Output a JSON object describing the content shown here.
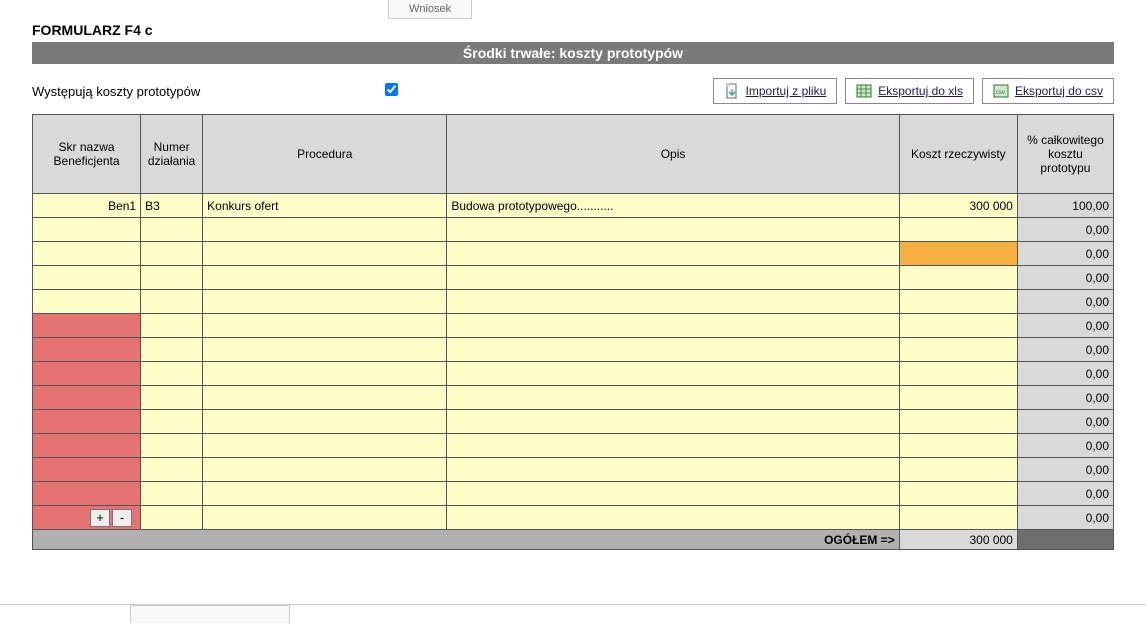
{
  "top_tab": "Wniosek",
  "form_title": "FORMULARZ F4 c",
  "banner": "Środki trwałe: koszty prototypów",
  "checkbox_label": "Występują koszty prototypów",
  "checkbox_checked": true,
  "buttons": {
    "import": "Importuj z pliku",
    "export_xls": "Eksportuj do xls",
    "export_csv": "Eksportuj do csv"
  },
  "columns": {
    "skr": "Skr nazwa Beneficjenta",
    "numer": "Numer działania",
    "procedura": "Procedura",
    "opis": "Opis",
    "koszt": "Koszt rzeczywisty",
    "pct": "% całkowitego kosztu prototypu"
  },
  "rows": [
    {
      "skr": "Ben1",
      "skr_align": "right",
      "skr_bg": "yellow",
      "numer": "B3",
      "procedura": "Konkurs ofert",
      "opis": "Budowa prototypowego...........",
      "koszt": "300 000",
      "koszt_bg": "yellow",
      "pct": "100,00"
    },
    {
      "skr": "",
      "skr_bg": "yellow",
      "numer": "",
      "procedura": "",
      "opis": "",
      "koszt": "",
      "koszt_bg": "yellow",
      "pct": "0,00"
    },
    {
      "skr": "",
      "skr_bg": "yellow",
      "numer": "",
      "procedura": "",
      "opis": "",
      "koszt": "",
      "koszt_bg": "orange",
      "pct": "0,00"
    },
    {
      "skr": "",
      "skr_bg": "yellow",
      "numer": "",
      "procedura": "",
      "opis": "",
      "koszt": "",
      "koszt_bg": "yellow",
      "pct": "0,00"
    },
    {
      "skr": "",
      "skr_bg": "yellow",
      "numer": "",
      "procedura": "",
      "opis": "",
      "koszt": "",
      "koszt_bg": "yellow",
      "pct": "0,00"
    },
    {
      "skr": "",
      "skr_bg": "red",
      "numer": "",
      "procedura": "",
      "opis": "",
      "koszt": "",
      "koszt_bg": "yellow",
      "pct": "0,00"
    },
    {
      "skr": "",
      "skr_bg": "red",
      "numer": "",
      "procedura": "",
      "opis": "",
      "koszt": "",
      "koszt_bg": "yellow",
      "pct": "0,00"
    },
    {
      "skr": "",
      "skr_bg": "red",
      "numer": "",
      "procedura": "",
      "opis": "",
      "koszt": "",
      "koszt_bg": "yellow",
      "pct": "0,00"
    },
    {
      "skr": "",
      "skr_bg": "red",
      "numer": "",
      "procedura": "",
      "opis": "",
      "koszt": "",
      "koszt_bg": "yellow",
      "pct": "0,00"
    },
    {
      "skr": "",
      "skr_bg": "red",
      "numer": "",
      "procedura": "",
      "opis": "",
      "koszt": "",
      "koszt_bg": "yellow",
      "pct": "0,00"
    },
    {
      "skr": "",
      "skr_bg": "red",
      "numer": "",
      "procedura": "",
      "opis": "",
      "koszt": "",
      "koszt_bg": "yellow",
      "pct": "0,00"
    },
    {
      "skr": "",
      "skr_bg": "red",
      "numer": "",
      "procedura": "",
      "opis": "",
      "koszt": "",
      "koszt_bg": "yellow",
      "pct": "0,00"
    },
    {
      "skr": "",
      "skr_bg": "red",
      "numer": "",
      "procedura": "",
      "opis": "",
      "koszt": "",
      "koszt_bg": "yellow",
      "pct": "0,00"
    },
    {
      "skr": "",
      "skr_bg": "red",
      "numer": "",
      "procedura": "",
      "opis": "",
      "koszt": "",
      "koszt_bg": "yellow",
      "pct": "0,00",
      "has_buttons": true
    }
  ],
  "row_btn_plus": "+",
  "row_btn_minus": "-",
  "total_label": "OGÓŁEM =>",
  "total_koszt": "300 000"
}
